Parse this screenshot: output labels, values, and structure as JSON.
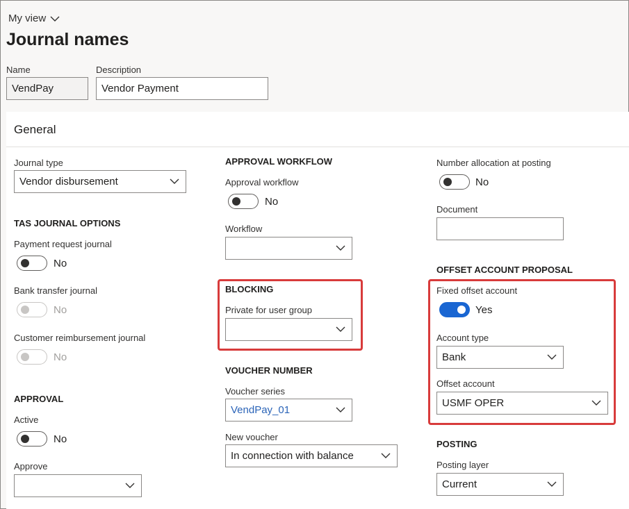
{
  "header": {
    "view_label": "My view",
    "page_title": "Journal names"
  },
  "identity": {
    "name_label": "Name",
    "name_value": "VendPay",
    "description_label": "Description",
    "description_value": "Vendor Payment"
  },
  "general": {
    "title": "General",
    "journal_type_label": "Journal type",
    "journal_type_value": "Vendor disbursement",
    "tas_section": "TAS JOURNAL OPTIONS",
    "payment_request_label": "Payment request journal",
    "payment_request_value": "No",
    "bank_transfer_label": "Bank transfer journal",
    "bank_transfer_value": "No",
    "customer_reimb_label": "Customer reimbursement journal",
    "customer_reimb_value": "No",
    "approval_section": "APPROVAL",
    "active_label": "Active",
    "active_value": "No",
    "approve_label": "Approve",
    "approve_value": "",
    "approval_workflow_section": "APPROVAL WORKFLOW",
    "approval_workflow_label": "Approval workflow",
    "approval_workflow_value": "No",
    "workflow_label": "Workflow",
    "workflow_value": "",
    "blocking_section": "BLOCKING",
    "private_group_label": "Private for user group",
    "private_group_value": "",
    "voucher_section": "VOUCHER NUMBER",
    "voucher_series_label": "Voucher series",
    "voucher_series_value": "VendPay_01",
    "new_voucher_label": "New voucher",
    "new_voucher_value": "In connection with balance",
    "number_alloc_label": "Number allocation at posting",
    "number_alloc_value": "No",
    "document_label": "Document",
    "document_value": "",
    "offset_section": "OFFSET ACCOUNT PROPOSAL",
    "fixed_offset_label": "Fixed offset account",
    "fixed_offset_value": "Yes",
    "account_type_label": "Account type",
    "account_type_value": "Bank",
    "offset_account_label": "Offset account",
    "offset_account_value": "USMF OPER",
    "posting_section": "POSTING",
    "posting_layer_label": "Posting layer",
    "posting_layer_value": "Current"
  },
  "colors": {
    "highlight": "#d83b3b",
    "toggle_on": "#1a66d2",
    "link": "#2b64b8"
  }
}
